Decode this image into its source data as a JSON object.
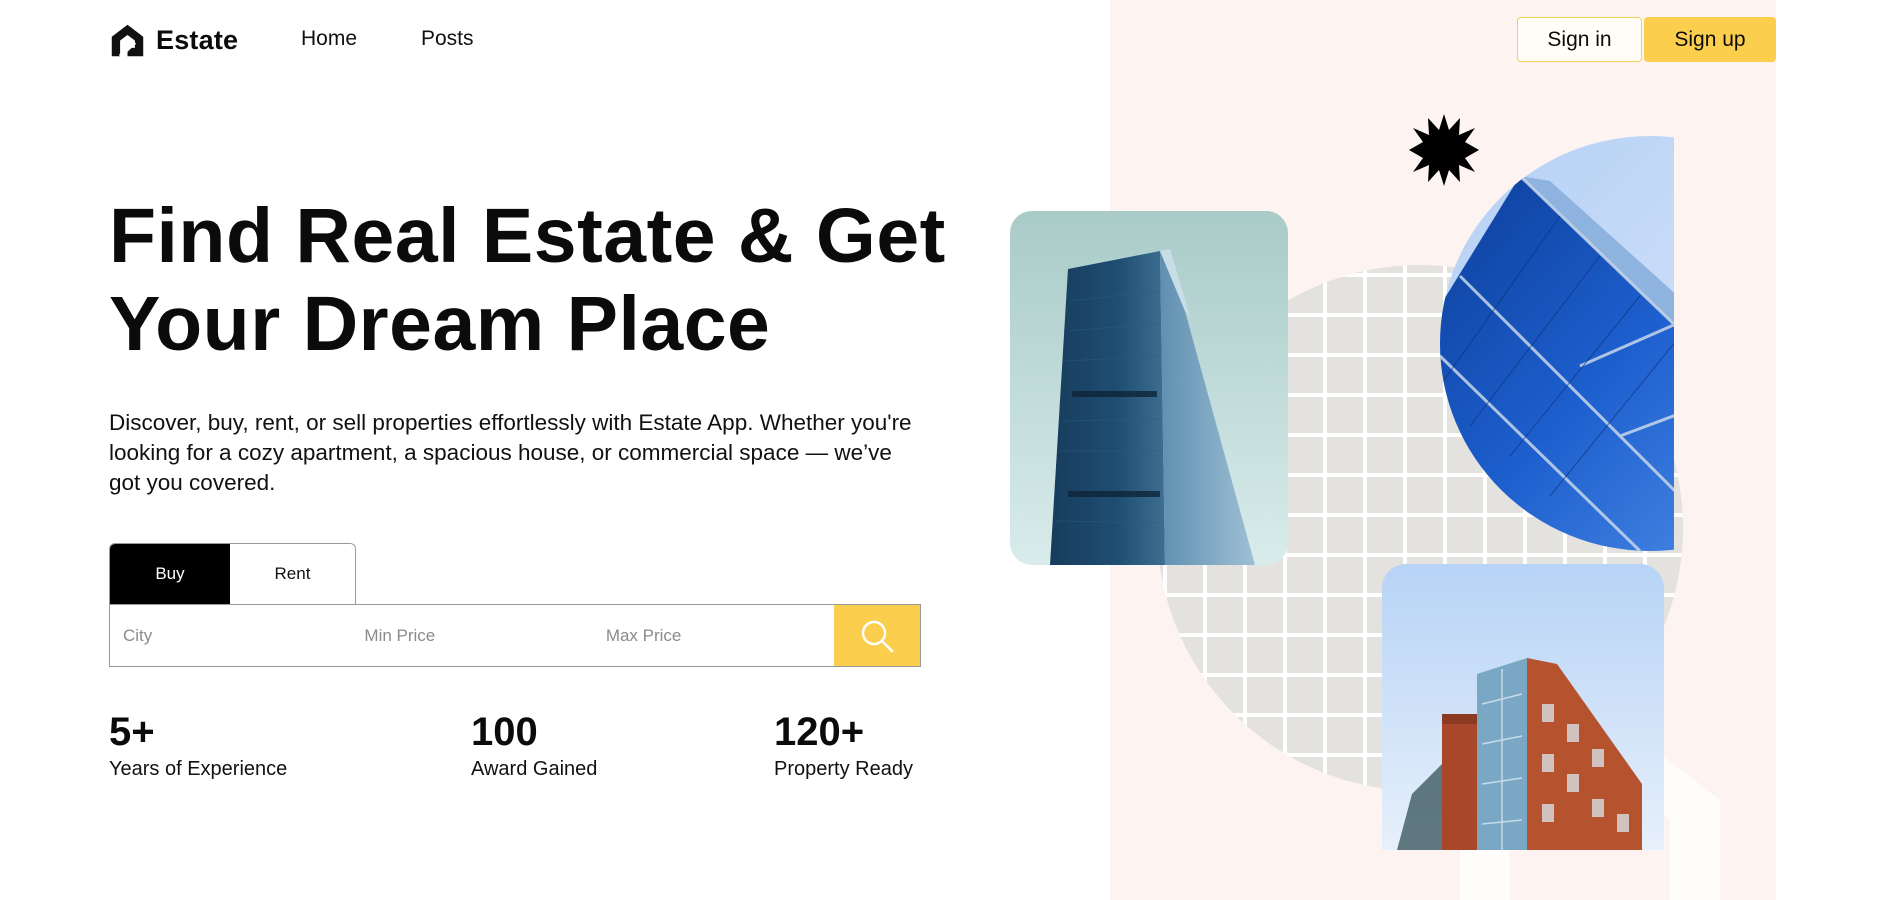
{
  "brand": {
    "name": "Estate"
  },
  "nav": {
    "home": "Home",
    "posts": "Posts"
  },
  "auth": {
    "sign_in": "Sign in",
    "sign_up": "Sign up"
  },
  "hero": {
    "title_line1": "Find Real Estate & Get",
    "title_line2": "Your Dream Place",
    "description": "Discover, buy, rent, or sell properties effortlessly with Estate App. Whether you're looking for a cozy apartment, a spacious house, or commercial space — we’ve got you covered."
  },
  "search": {
    "tabs": [
      {
        "label": "Buy",
        "active": true
      },
      {
        "label": "Rent",
        "active": false
      }
    ],
    "city_placeholder": "City",
    "min_price_placeholder": "Min Price",
    "max_price_placeholder": "Max Price",
    "button_icon": "search-icon"
  },
  "stats": [
    {
      "value": "5+",
      "label": "Years of Experience"
    },
    {
      "value": "100",
      "label": "Award Gained"
    },
    {
      "value": "120+",
      "label": "Property Ready"
    }
  ],
  "colors": {
    "accent": "#fbce4e",
    "panel_bg": "#fdf3f1",
    "text": "#0b0b0b"
  },
  "decor": {
    "star_icon": "starburst-icon",
    "logo_icon": "estate-logo-icon"
  }
}
